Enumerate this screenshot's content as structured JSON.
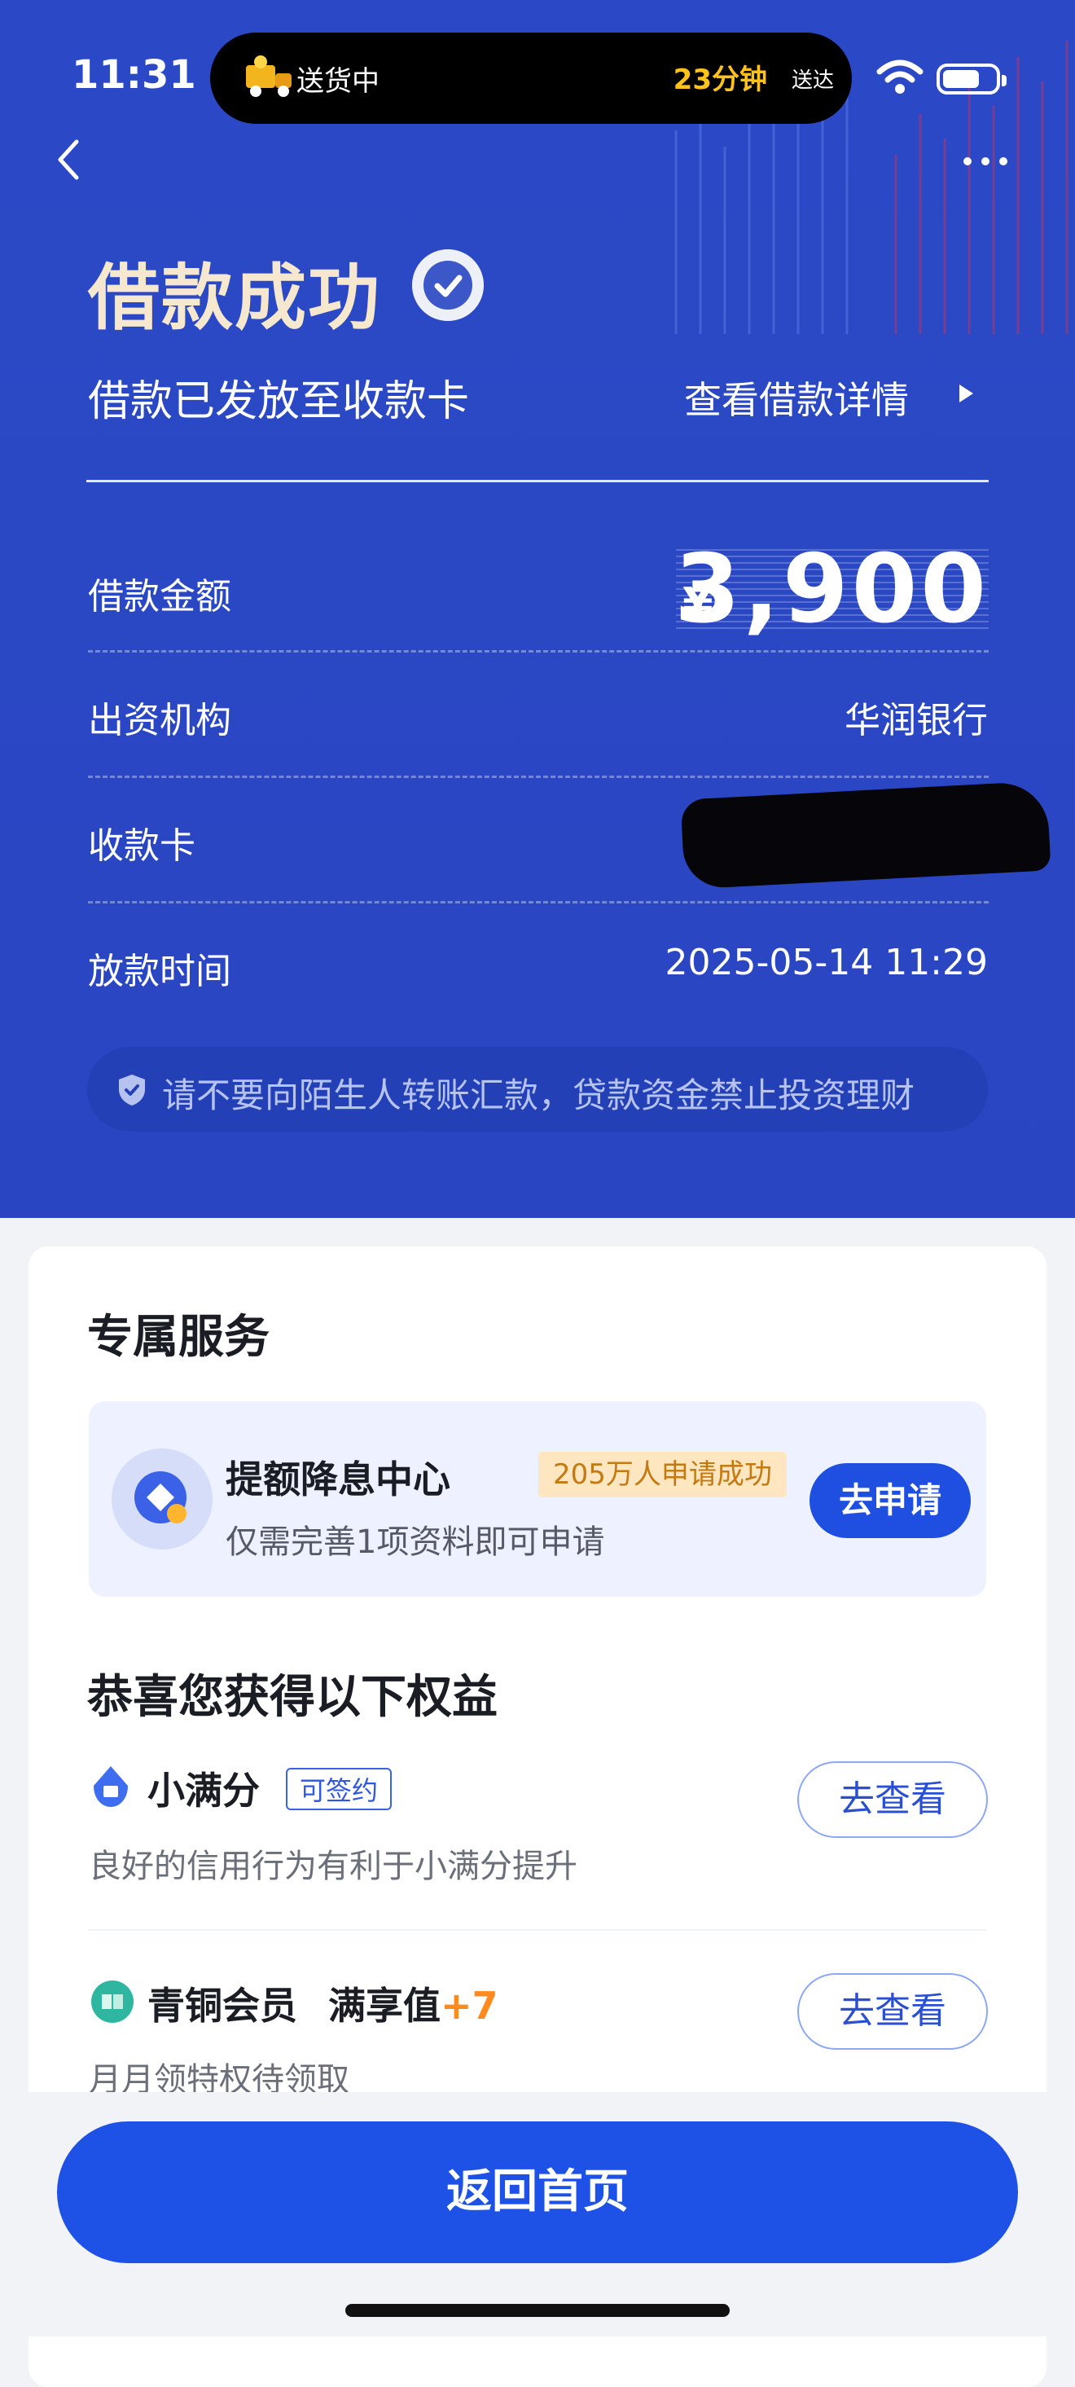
{
  "status_bar": {
    "time": "11:31",
    "activity_label": "送货中",
    "activity_eta": "23分钟",
    "activity_eta_suffix": "送达"
  },
  "header": {
    "title": "借款成功",
    "subtitle": "借款已发放至收款卡",
    "detail_link": "查看借款详情"
  },
  "loan": {
    "amount_label": "借款金额",
    "currency_symbol": "¥",
    "amount_value": "3,900",
    "lender_label": "出资机构",
    "lender_value": "华润银行",
    "card_label": "收款卡",
    "time_label": "放款时间",
    "time_value": "2025-05-14 11:29"
  },
  "warning": "请不要向陌生人转账汇款，贷款资金禁止投资理财",
  "services": {
    "title": "专属服务",
    "item": {
      "name": "提额降息中心",
      "badge": "205万人申请成功",
      "desc": "仅需完善1项资料即可申请",
      "button": "去申请"
    }
  },
  "benefits": {
    "title": "恭喜您获得以下权益",
    "items": [
      {
        "name": "小满分",
        "tag": "可签约",
        "desc": "良好的信用行为有利于小满分提升",
        "button": "去查看"
      },
      {
        "name": "青铜会员",
        "extra": "满享值",
        "plus": "+7",
        "desc": "月月领特权待领取",
        "button": "去查看"
      }
    ]
  },
  "footer": {
    "home_button": "返回首页"
  },
  "colors": {
    "header_bg": "#2b49c6",
    "primary": "#1e52e6",
    "badge_bg": "#fde6c0",
    "accent_orange": "#ff8a1f"
  }
}
